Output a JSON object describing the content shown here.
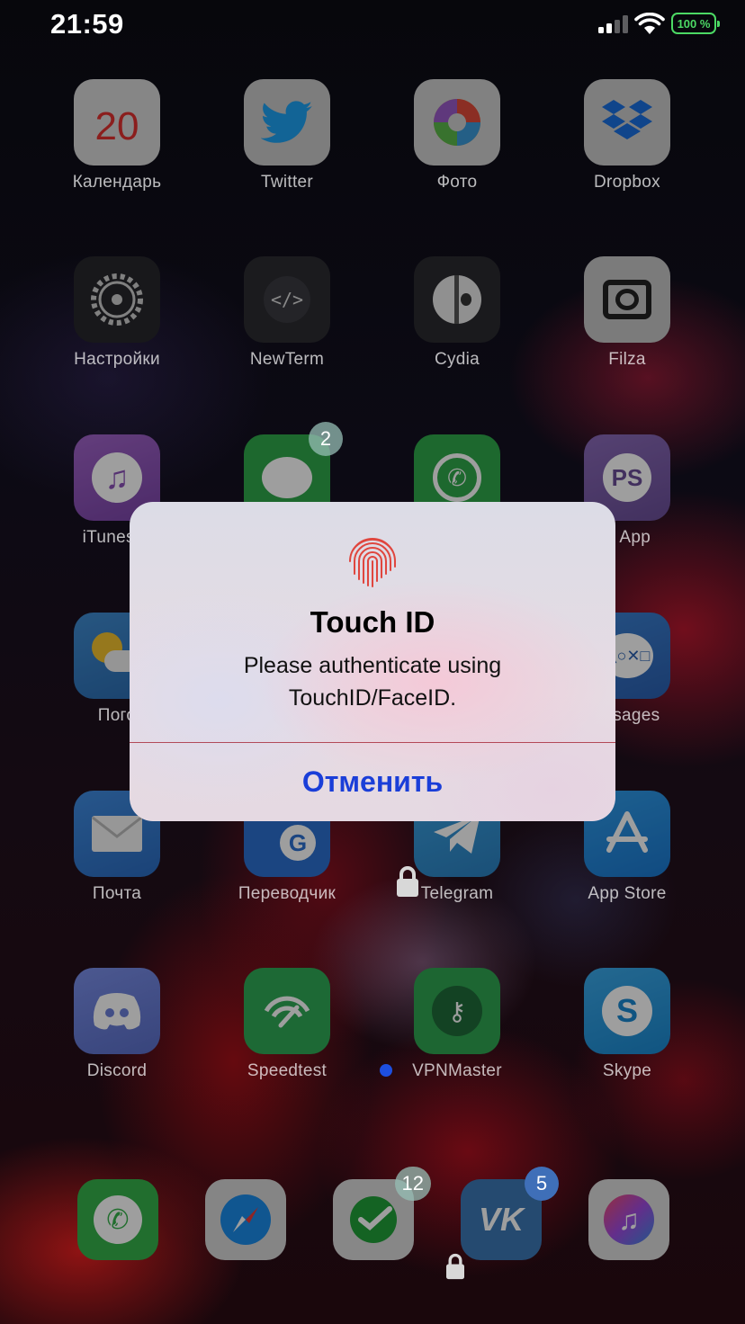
{
  "status_bar": {
    "time": "21:59",
    "battery": "100 %",
    "battery_color": "#4cd964"
  },
  "apps": [
    {
      "label": "Календарь",
      "icon": "calendar-icon",
      "date": "20"
    },
    {
      "label": "Twitter",
      "icon": "twitter-icon"
    },
    {
      "label": "Фото",
      "icon": "photos-icon"
    },
    {
      "label": "Dropbox",
      "icon": "dropbox-icon"
    },
    {
      "label": "Настройки",
      "icon": "settings-icon"
    },
    {
      "label": "NewTerm",
      "icon": "terminal-icon"
    },
    {
      "label": "Cydia",
      "icon": "cydia-icon"
    },
    {
      "label": "Filza",
      "icon": "filza-icon"
    },
    {
      "label": "iTunes S",
      "icon": "itunes-store-icon"
    },
    {
      "label": "",
      "icon": "messages-icon",
      "badge": "2"
    },
    {
      "label": "",
      "icon": "whatsapp-icon"
    },
    {
      "label": "S App",
      "icon": "playstation-icon"
    },
    {
      "label": "Пого",
      "icon": "weather-icon"
    },
    {
      "label": "essages",
      "icon": "ps-messages-icon"
    },
    {
      "label": "Почта",
      "icon": "mail-icon"
    },
    {
      "label": "Переводчик",
      "icon": "translate-icon"
    },
    {
      "label": "Telegram",
      "icon": "telegram-icon"
    },
    {
      "label": "App Store",
      "icon": "app-store-icon"
    },
    {
      "label": "Discord",
      "icon": "discord-icon"
    },
    {
      "label": "Speedtest",
      "icon": "speedtest-icon"
    },
    {
      "label": "VPNMaster",
      "icon": "vpn-key-icon"
    },
    {
      "label": "Skype",
      "icon": "skype-icon"
    }
  ],
  "dock": [
    {
      "icon": "phone-icon"
    },
    {
      "icon": "safari-icon"
    },
    {
      "icon": "sberbank-icon",
      "badge": "12"
    },
    {
      "icon": "vk-icon",
      "badge": "5"
    },
    {
      "icon": "music-icon"
    }
  ],
  "alert": {
    "icon": "fingerprint-icon",
    "title": "Touch ID",
    "message": "Please authenticate using TouchID/FaceID.",
    "cancel_label": "Отменить",
    "accent_color": "#1a3ed8"
  }
}
